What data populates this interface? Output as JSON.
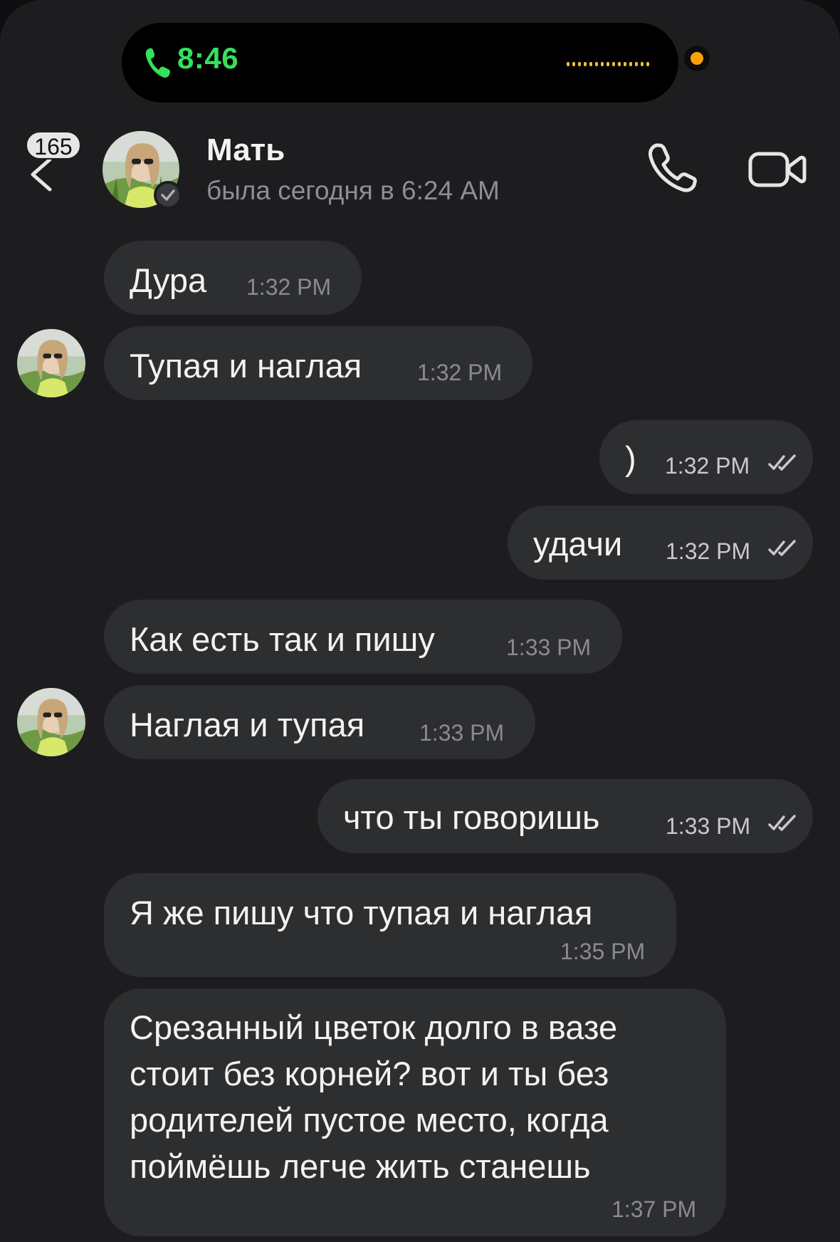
{
  "status_bar": {
    "call_time": "8:46",
    "icons": [
      "phone-icon",
      "audio-wave-icon",
      "recording-dot-icon"
    ]
  },
  "header": {
    "back_badge": "165",
    "contact_name": "Мать",
    "status": "была сегодня в 6:24 AM",
    "icons": [
      "chevron-left-icon",
      "checkmark-badge-icon",
      "phone-icon",
      "video-camera-icon"
    ]
  },
  "messages": [
    {
      "direction": "in",
      "text": "Дура",
      "time": "1:32 PM"
    },
    {
      "direction": "in",
      "text": "Тупая и наглая",
      "time": "1:32 PM"
    },
    {
      "direction": "out",
      "text": ")",
      "time": "1:32 PM",
      "read": true
    },
    {
      "direction": "out",
      "text": "удачи",
      "time": "1:32 PM",
      "read": true
    },
    {
      "direction": "in",
      "text": "Как есть так и пишу",
      "time": "1:33 PM"
    },
    {
      "direction": "in",
      "text": "Наглая и тупая",
      "time": "1:33 PM"
    },
    {
      "direction": "out",
      "text": "что ты говоришь",
      "time": "1:33 PM",
      "read": true
    },
    {
      "direction": "in",
      "text": "Я же пишу что тупая и наглая",
      "time": "1:35 PM"
    },
    {
      "direction": "in",
      "text": "Срезанный цветок долго в вазе стоит без корней? вот и ты без родителей пустое место, когда поймёшь легче жить станешь",
      "time": "1:37 PM"
    }
  ],
  "colors": {
    "background": "#1d1d1f",
    "bubble": "#2d2e30",
    "island_text": "#35e05c",
    "recording_dot": "#ff9f0a",
    "secondary_text": "#8e8e93"
  }
}
